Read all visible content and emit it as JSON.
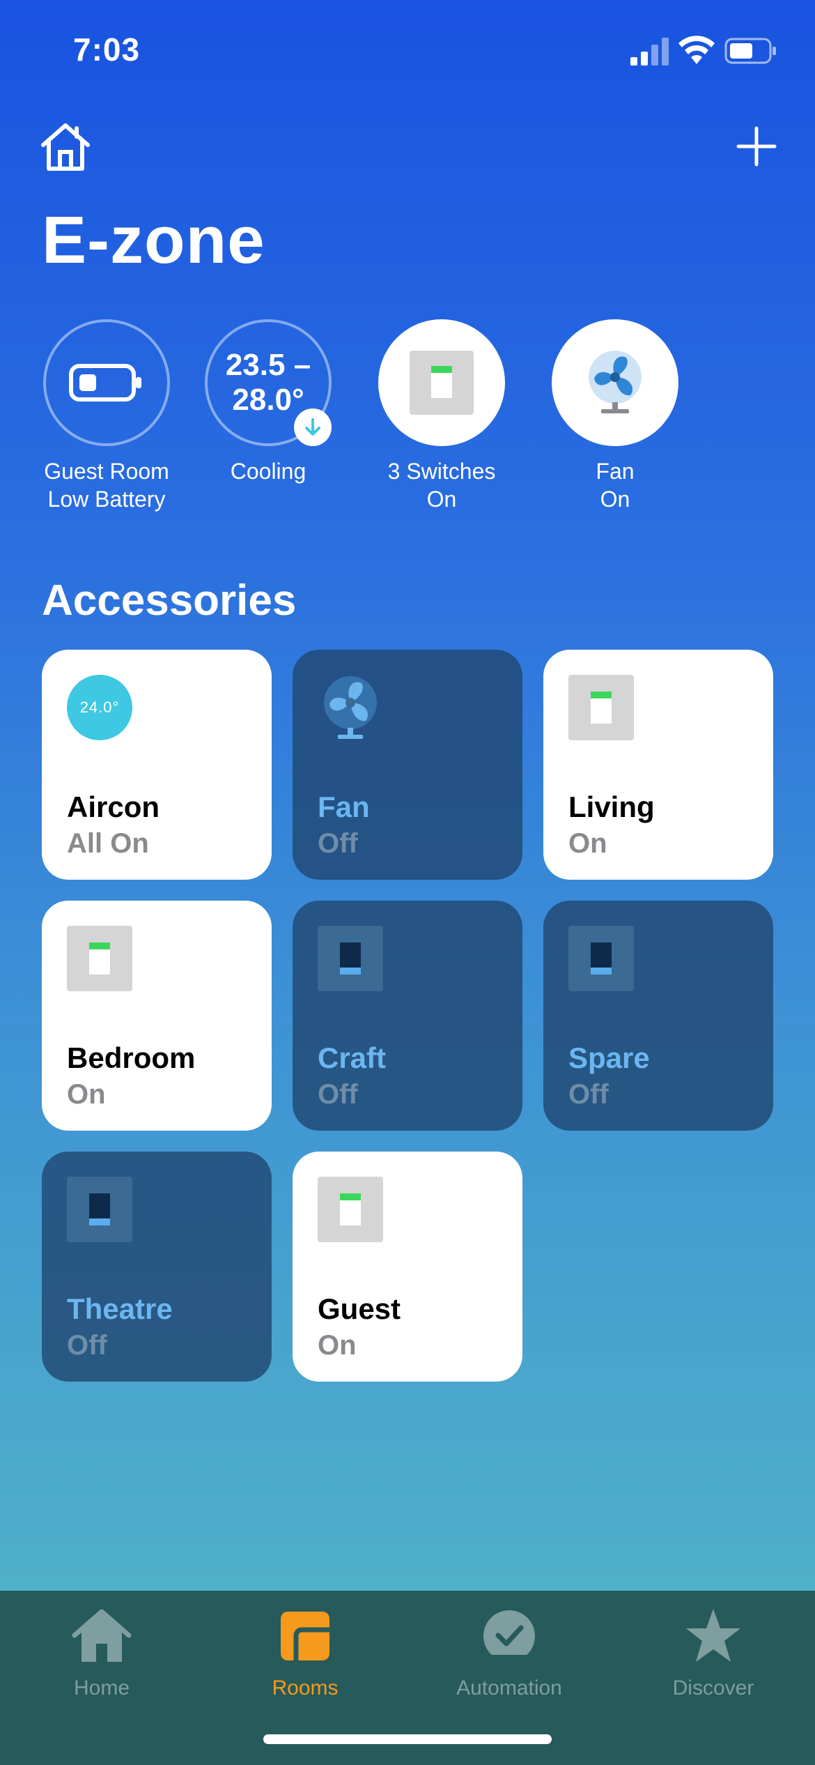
{
  "status_bar": {
    "time": "7:03"
  },
  "header": {
    "title": "E-zone"
  },
  "status_items": [
    {
      "line1": "Guest Room",
      "line2": "Low Battery"
    },
    {
      "range_line1": "23.5 –",
      "range_line2": "28.0°",
      "line1": "Cooling"
    },
    {
      "line1": "3 Switches",
      "line2": "On"
    },
    {
      "line1": "Fan",
      "line2": "On"
    }
  ],
  "accessories": {
    "title": "Accessories",
    "tiles": [
      {
        "name": "Aircon",
        "status": "All On",
        "temp": "24.0°"
      },
      {
        "name": "Fan",
        "status": "Off"
      },
      {
        "name": "Living",
        "status": "On"
      },
      {
        "name": "Bedroom",
        "status": "On"
      },
      {
        "name": "Craft",
        "status": "Off"
      },
      {
        "name": "Spare",
        "status": "Off"
      },
      {
        "name": "Theatre",
        "status": "Off"
      },
      {
        "name": "Guest",
        "status": "On"
      }
    ]
  },
  "tab_bar": {
    "tabs": [
      {
        "label": "Home",
        "icon": "house-icon"
      },
      {
        "label": "Rooms",
        "icon": "rooms-icon"
      },
      {
        "label": "Automation",
        "icon": "clock-check-icon"
      },
      {
        "label": "Discover",
        "icon": "star-icon"
      }
    ],
    "active": "Rooms"
  },
  "colors": {
    "accent_active_tab": "#f59a1c",
    "switch_on_indicator": "#3dd65c",
    "aircon_circle": "#3ec8e2"
  }
}
